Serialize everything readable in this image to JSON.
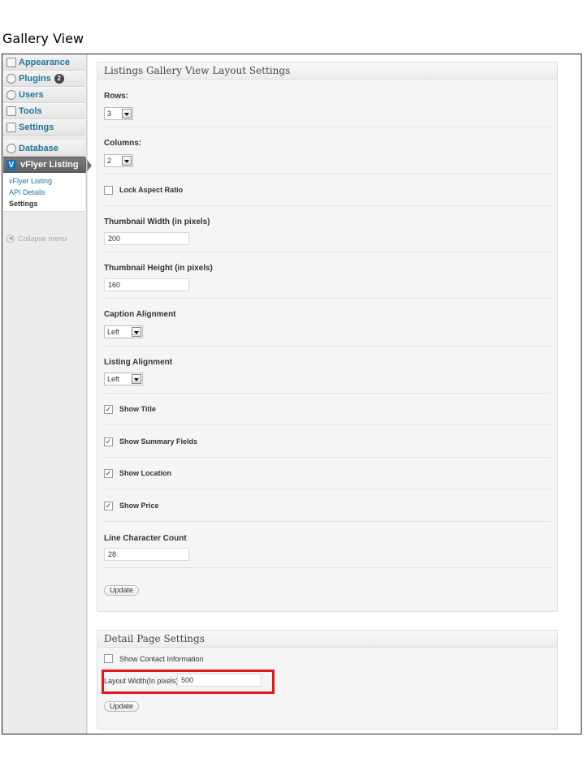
{
  "page_title": "Gallery View",
  "sidebar": {
    "items": [
      {
        "label": "Appearance",
        "icon": "appearance-icon"
      },
      {
        "label": "Plugins",
        "icon": "plugins-icon",
        "badge": "2"
      },
      {
        "label": "Users",
        "icon": "users-icon"
      },
      {
        "label": "Tools",
        "icon": "tools-icon"
      },
      {
        "label": "Settings",
        "icon": "settings-icon"
      },
      {
        "label": "Database",
        "icon": "database-icon"
      },
      {
        "label": "vFlyer Listing",
        "icon": "vflyer-logo-icon",
        "logo_letter": "V"
      }
    ],
    "submenu": [
      "vFlyer Listing",
      "API Details",
      "Settings"
    ],
    "collapse_label": "Collapse menu"
  },
  "gallery_panel": {
    "title": "Listings Gallery View Layout Settings",
    "rows_label": "Rows:",
    "rows_value": "3",
    "columns_label": "Columns:",
    "columns_value": "2",
    "lock_aspect_label": "Lock Aspect Ratio",
    "lock_aspect_checked": false,
    "thumb_width_label": "Thumbnail Width (in pixels)",
    "thumb_width_value": "200",
    "thumb_height_label": "Thumbnail Height (in pixels)",
    "thumb_height_value": "160",
    "caption_align_label": "Caption Alignment",
    "caption_align_value": "Left",
    "listing_align_label": "Listing Alignment",
    "listing_align_value": "Left",
    "show_title_label": "Show Title",
    "show_summary_label": "Show Summary Fields",
    "show_location_label": "Show Location",
    "show_price_label": "Show Price",
    "line_char_label": "Line Character Count",
    "line_char_value": "28",
    "update_label": "Update"
  },
  "detail_panel": {
    "title": "Detail Page Settings",
    "show_contact_label": "Show Contact Information",
    "show_contact_checked": false,
    "layout_width_label": "Layout Width(In pixels)",
    "layout_width_value": "500",
    "update_label": "Update"
  },
  "colors": {
    "link_blue": "#21759b",
    "highlight_red": "#e1161f",
    "active_menu_bg": "#6b6b6b"
  }
}
